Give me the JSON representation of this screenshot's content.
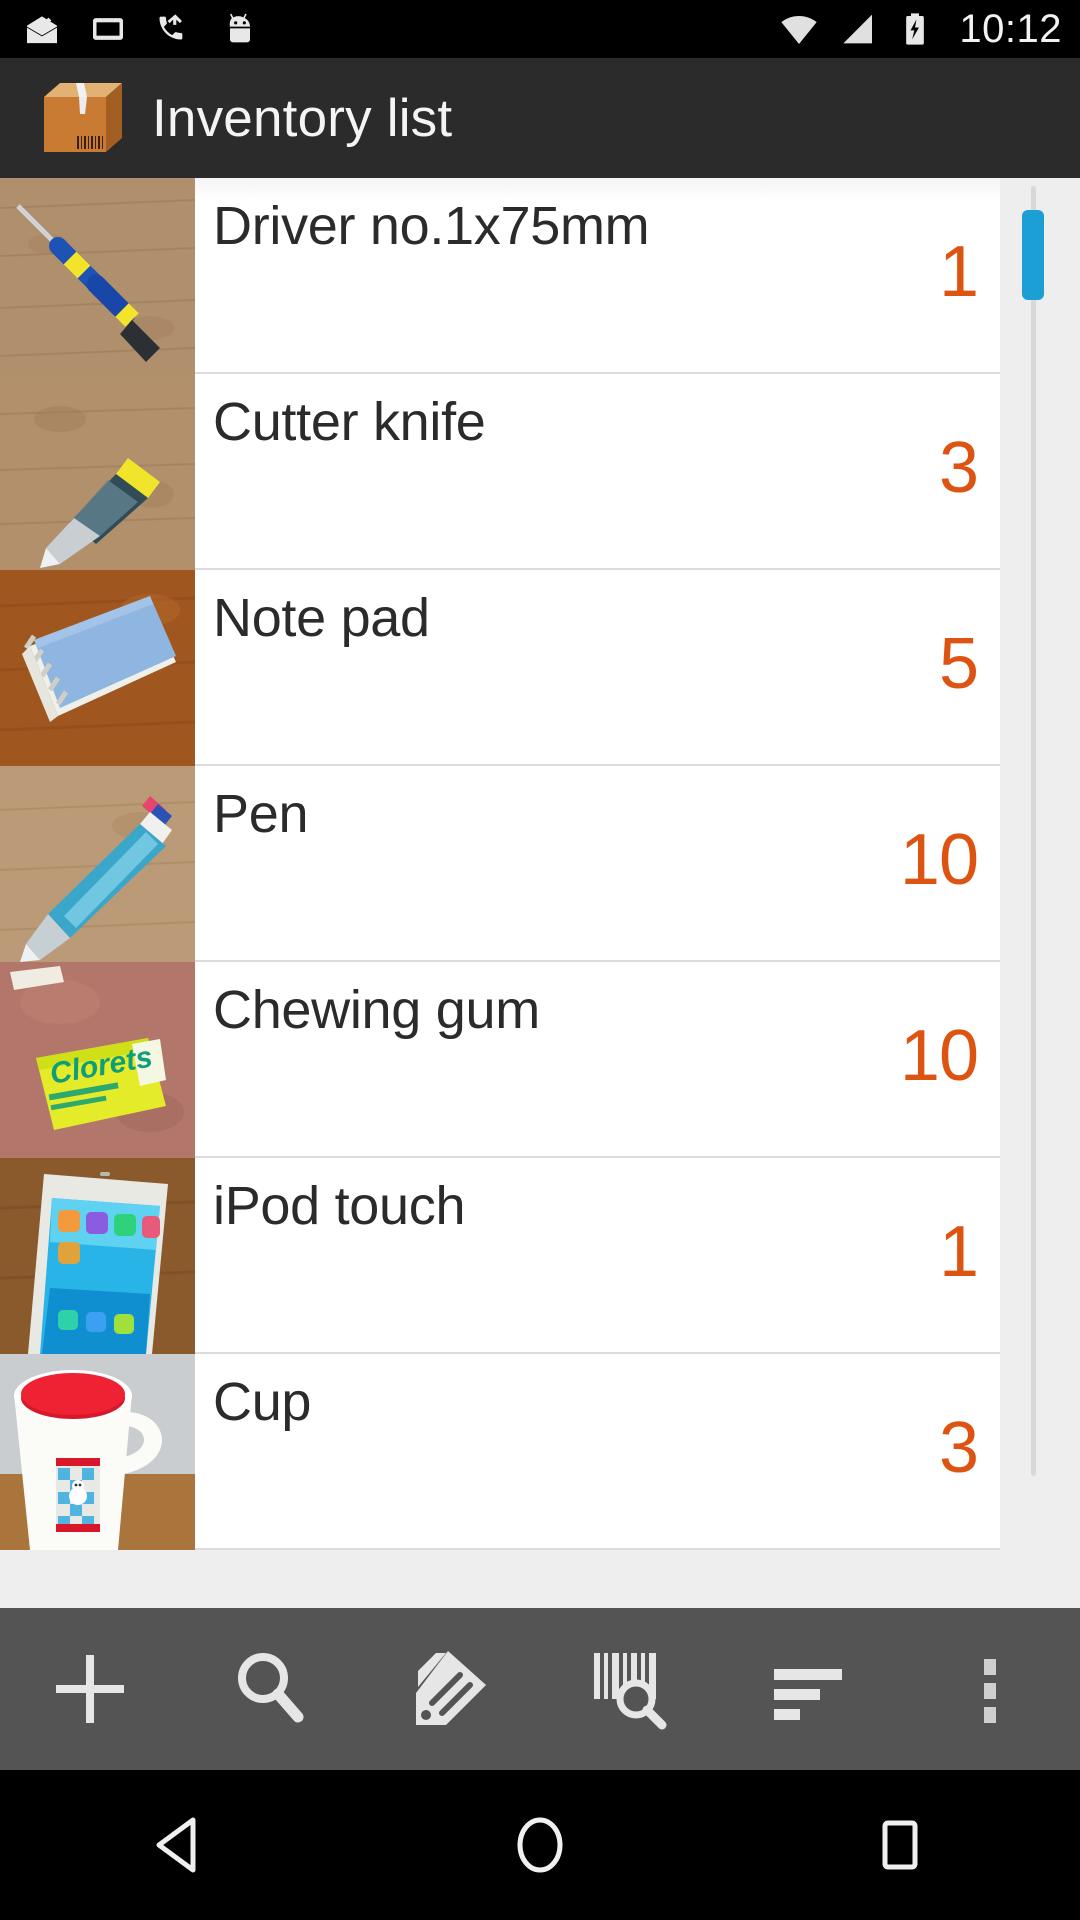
{
  "status_bar": {
    "notifications": [
      {
        "name": "inbox-check-icon"
      },
      {
        "name": "screenshot-icon"
      },
      {
        "name": "missed-call-icon"
      },
      {
        "name": "android-head-icon"
      }
    ],
    "wifi_icon": "wifi-icon",
    "signal_icon": "cell-signal-icon",
    "battery_icon": "battery-charging-icon",
    "clock": "10:12"
  },
  "app_bar": {
    "icon": "cardboard-box-icon",
    "title": "Inventory list"
  },
  "list": {
    "items": [
      {
        "name": "Driver no.1x75mm",
        "qty": "1",
        "thumb": "screwdriver-photo"
      },
      {
        "name": "Cutter knife",
        "qty": "3",
        "thumb": "cutter-knife-photo"
      },
      {
        "name": "Note pad",
        "qty": "5",
        "thumb": "note-pad-photo"
      },
      {
        "name": "Pen",
        "qty": "10",
        "thumb": "pen-photo"
      },
      {
        "name": "Chewing gum",
        "qty": "10",
        "thumb": "chewing-gum-photo"
      },
      {
        "name": "iPod touch",
        "qty": "1",
        "thumb": "ipod-touch-photo"
      },
      {
        "name": "Cup",
        "qty": "3",
        "thumb": "cup-photo"
      }
    ]
  },
  "toolbar": {
    "buttons": [
      {
        "name": "add-item-button",
        "icon": "plus-icon"
      },
      {
        "name": "search-button",
        "icon": "magnifier-icon"
      },
      {
        "name": "edit-tag-button",
        "icon": "tag-pencil-icon"
      },
      {
        "name": "barcode-scan-button",
        "icon": "barcode-search-icon"
      },
      {
        "name": "sort-button",
        "icon": "sort-lines-icon"
      },
      {
        "name": "overflow-menu-button",
        "icon": "more-vertical-icon"
      }
    ]
  },
  "nav_bar": {
    "buttons": [
      {
        "name": "nav-back-button",
        "icon": "triangle-back-icon"
      },
      {
        "name": "nav-home-button",
        "icon": "circle-home-icon"
      },
      {
        "name": "nav-recent-button",
        "icon": "square-recents-icon"
      }
    ]
  },
  "colors": {
    "accent_qty": "#dd5412",
    "scrollbar_thumb": "#1b9fd4",
    "app_bar_bg": "#2b2b2b",
    "toolbar_bg": "#545454"
  }
}
